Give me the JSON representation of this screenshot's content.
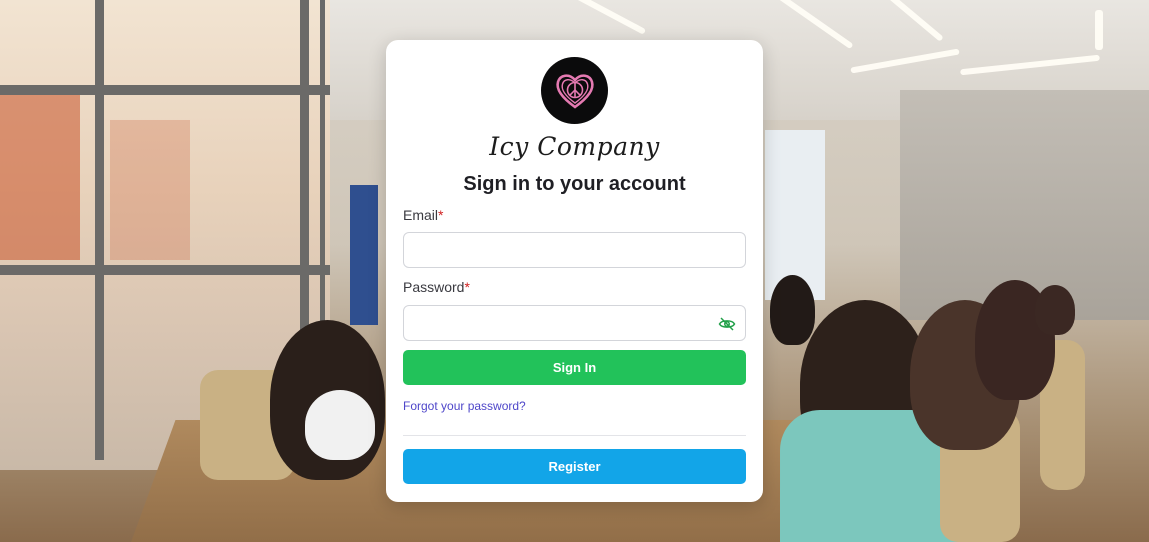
{
  "brand": {
    "name": "Icy Company",
    "logo_icon": "heart-peace-icon",
    "logo_color": "#e57ab2"
  },
  "form": {
    "heading": "Sign in to your account",
    "email": {
      "label": "Email",
      "required_mark": "*",
      "value": "",
      "placeholder": ""
    },
    "password": {
      "label": "Password",
      "required_mark": "*",
      "value": "",
      "placeholder": "",
      "toggle_icon": "eye-slash-icon"
    },
    "sign_in_label": "Sign In",
    "forgot_label": "Forgot your password?",
    "register_label": "Register"
  },
  "colors": {
    "sign_in": "#22c25a",
    "register": "#12a5e8",
    "link": "#4e46c9",
    "required": "#d02020",
    "eye_icon": "#22a04a"
  }
}
